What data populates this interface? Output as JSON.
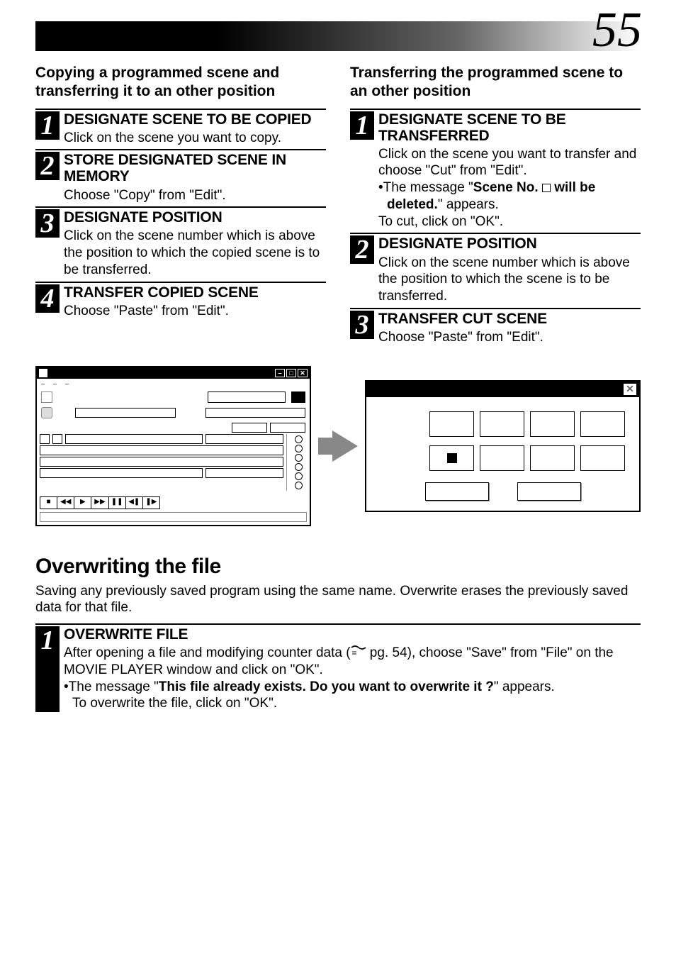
{
  "page_number": "55",
  "left": {
    "title": "Copying a programmed scene and transferring it to an other position",
    "steps": [
      {
        "head": "DESIGNATE SCENE TO BE COPIED",
        "text": "Click on the scene you want to copy."
      },
      {
        "head": "STORE DESIGNATED SCENE IN MEMORY",
        "text": "Choose \"Copy\" from \"Edit\"."
      },
      {
        "head": "DESIGNATE POSITION",
        "text": "Click on the scene number which is above the position to which the copied scene is to be transferred."
      },
      {
        "head": "TRANSFER COPIED SCENE",
        "text": "Choose \"Paste\" from \"Edit\"."
      }
    ]
  },
  "right": {
    "title": "Transferring the programmed scene to an other position",
    "steps": [
      {
        "head": "DESIGNATE SCENE TO BE TRANSFERRED",
        "text": "Click on the scene you want to transfer and choose \"Cut\" from \"Edit\".",
        "bullet_pre": "•The message \"",
        "bullet_bold_a": "Scene No. ",
        "bullet_bold_b": " will be deleted.",
        "bullet_post": "\" appears.",
        "tail": "To cut, click on \"OK\"."
      },
      {
        "head": "DESIGNATE POSITION",
        "text": "Click on the scene number which is above the position to which the scene is to be transferred."
      },
      {
        "head": "TRANSFER CUT SCENE",
        "text": "Choose \"Paste\" from \"Edit\"."
      }
    ]
  },
  "overwrite": {
    "heading": "Overwriting the file",
    "intro": "Saving any previously saved program using the same name. Overwrite erases the previously saved data for that file.",
    "step_head": "OVERWRITE FILE",
    "line1_a": "After opening a file and modifying counter data (",
    "line1_b": " pg. 54), choose \"Save\" from \"File\" on the MOVIE PLAYER window and click on \"OK\".",
    "bullet_pre": "•The message \"",
    "bullet_bold": "This file already exists. Do you want to overwrite it ?",
    "bullet_post": "\" appears.",
    "tail": "To overwrite the file, click on \"OK\"."
  },
  "ui": {
    "menus": [
      "–",
      "–",
      "–"
    ],
    "transport": [
      "■",
      "◀◀",
      "▶",
      "▶▶",
      "❚❚",
      "◀❚",
      "❚▶"
    ],
    "win_btns": [
      "–",
      "□",
      "✕"
    ],
    "id_close": "✕"
  }
}
